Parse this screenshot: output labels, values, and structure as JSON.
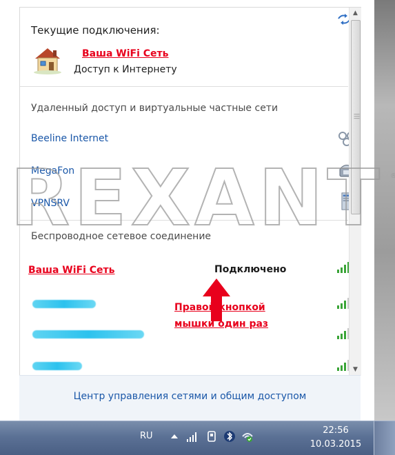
{
  "current": {
    "title": "Текущие подключения:",
    "network_name": "Ваша WiFi Сеть",
    "access": "Доступ к Интернету"
  },
  "remote_section": {
    "title": "Удаленный доступ и виртуальные частные сети",
    "items": [
      {
        "label": "Beeline Internet",
        "icon": "vpn-connector-icon"
      },
      {
        "label": "MegaFon",
        "icon": "dialup-phone-icon"
      },
      {
        "label": "VPNSRV",
        "icon": "server-tower-icon"
      }
    ]
  },
  "wireless_section": {
    "title": "Беспроводное сетевое соединение",
    "connected_name": "Ваша WiFi Сеть",
    "connected_status": "Подключено"
  },
  "annotation": {
    "line1": "Правой кнопкой",
    "line2": "мышки один раз"
  },
  "footer": {
    "link": "Центр управления сетями и общим доступом"
  },
  "watermark": "REXANT",
  "taskbar": {
    "lang": "RU",
    "time": "22:56",
    "date": "10.03.2015"
  },
  "colors": {
    "link_blue": "#1a57a8",
    "annotation_red": "#e8001c",
    "signal_green": "#3aa437"
  }
}
